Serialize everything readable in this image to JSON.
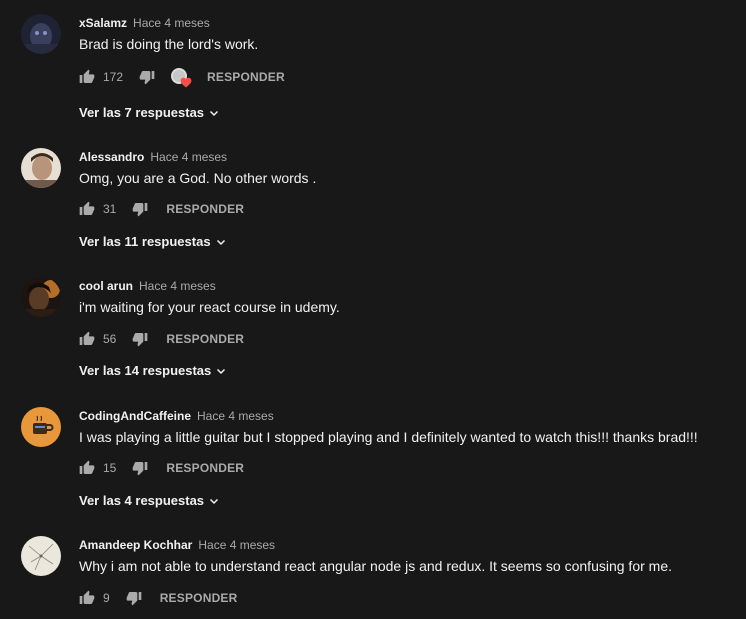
{
  "comments": [
    {
      "author": "xSalamz",
      "time": "Hace 4 meses",
      "text": "Brad is doing the lord's work.",
      "likes": "172",
      "reply_label": "RESPONDER",
      "replies_label": "Ver las 7 respuestas",
      "has_creator_heart": true,
      "avatar_color": "#2a2d40"
    },
    {
      "author": "Alessandro",
      "time": "Hace 4 meses",
      "text": "Omg, you are a God. No other words .",
      "likes": "31",
      "reply_label": "RESPONDER",
      "replies_label": "Ver las 11 respuestas",
      "has_creator_heart": false,
      "avatar_color": "#c9b4a0"
    },
    {
      "author": "cool arun",
      "time": "Hace 4 meses",
      "text": "i'm waiting for your react course in udemy.",
      "likes": "56",
      "reply_label": "RESPONDER",
      "replies_label": "Ver las 14 respuestas",
      "has_creator_heart": false,
      "avatar_color": "#3b2a1e"
    },
    {
      "author": "CodingAndCaffeine",
      "time": "Hace 4 meses",
      "text": "I was playing a little guitar but I stopped playing and I definitely wanted to watch this!!! thanks brad!!!",
      "likes": "15",
      "reply_label": "RESPONDER",
      "replies_label": "Ver las 4 respuestas",
      "has_creator_heart": false,
      "avatar_color": "#e8973a"
    },
    {
      "author": "Amandeep Kochhar",
      "time": "Hace 4 meses",
      "text": "Why i am not able to understand react angular node js and redux. It seems so confusing for me.",
      "likes": "9",
      "reply_label": "RESPONDER",
      "has_creator_heart": false,
      "avatar_color": "#e9e6dc"
    }
  ],
  "colors": {
    "background": "#181818",
    "primary_text": "#f1f1f1",
    "secondary_text": "#aaaaaa",
    "heart": "#ff4e45"
  },
  "icons": {
    "like": "thumbs-up-icon",
    "dislike": "thumbs-down-icon",
    "expand": "chevron-down-icon",
    "creator_heart": "creator-heart-icon"
  }
}
